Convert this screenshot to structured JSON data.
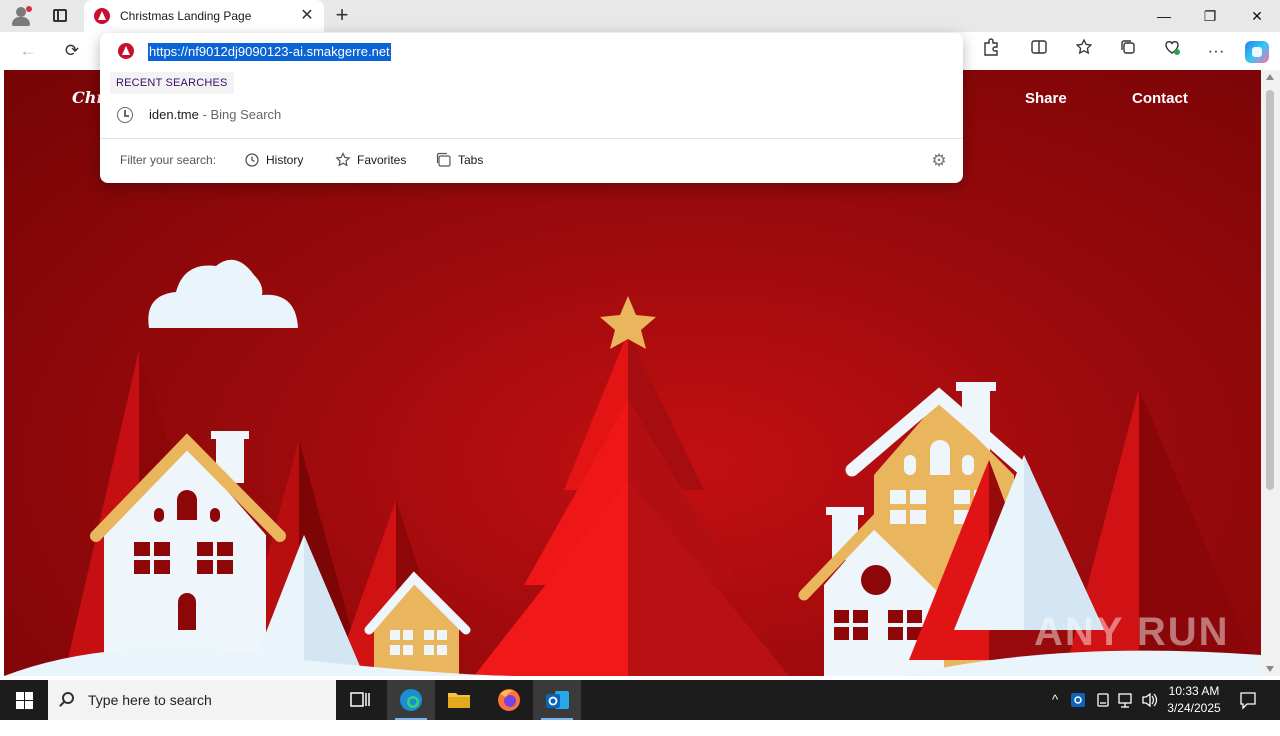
{
  "browser": {
    "tab": {
      "title": "Christmas Landing Page",
      "close": "✕"
    },
    "new_tab": "+",
    "window_controls": {
      "minimize": "—",
      "restore": "❐",
      "close": "✕"
    },
    "toolbar": {
      "back": "←",
      "refresh": "⟳",
      "more": "···"
    }
  },
  "omnibox": {
    "url": "https://nf9012dj9090123-ai.smakgerre.net",
    "recent_label": "RECENT SEARCHES",
    "recent": [
      {
        "query": "iden.tme",
        "source": "Bing Search"
      }
    ],
    "filter_label": "Filter your search:",
    "filters": [
      {
        "label": "History",
        "icon": "history-icon"
      },
      {
        "label": "Favorites",
        "icon": "star-icon"
      },
      {
        "label": "Tabs",
        "icon": "tabs-icon"
      }
    ]
  },
  "page": {
    "logo": "Chri",
    "nav": {
      "share": "Share",
      "contact": "Contact"
    },
    "watermark": "ANY RUN",
    "colors": {
      "background": "#9a0a0c",
      "tree": "#e51414",
      "gold": "#e9b65e",
      "snow": "#eef6fc"
    }
  },
  "taskbar": {
    "search_placeholder": "Type here to search",
    "time": "10:33 AM",
    "date": "3/24/2025"
  }
}
